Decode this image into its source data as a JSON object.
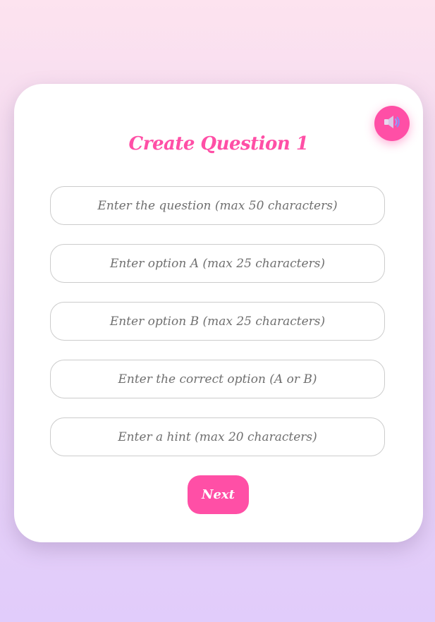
{
  "title": "Create Question 1",
  "sound_button": {
    "icon": "speaker-volume-icon"
  },
  "fields": {
    "question_placeholder": "Enter the question (max 50 characters)",
    "option_a_placeholder": "Enter option A (max 25 characters)",
    "option_b_placeholder": "Enter option B (max 25 characters)",
    "correct_option_placeholder": "Enter the correct option (A or B)",
    "hint_placeholder": "Enter a hint (max 20 characters)"
  },
  "next_label": "Next",
  "colors": {
    "accent": "#ff4fa6",
    "card": "#ffffff",
    "background_top": "#fde3ef",
    "background_bottom": "#e1ccfb",
    "field_border": "#cccccc",
    "placeholder": "#6f6f6f"
  }
}
